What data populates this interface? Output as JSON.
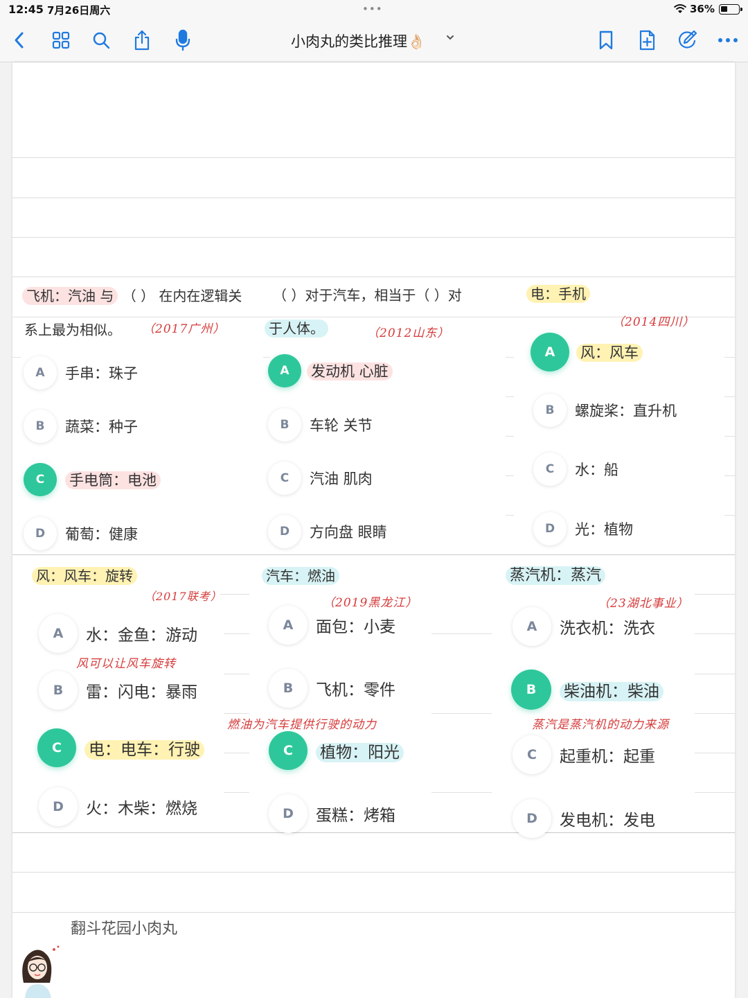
{
  "status_bar": {
    "time": "12:45",
    "date": "7月26日周六",
    "dots": "•••",
    "battery": "36%"
  },
  "toolbar": {
    "title": "小肉丸的类比推理👌🏻",
    "icons": [
      "back-icon",
      "grid-icon",
      "search-icon",
      "share-icon",
      "microphone-icon",
      "bookmark-icon",
      "add-page-icon",
      "markup-icon",
      "more-icon"
    ]
  },
  "q1": {
    "stem_hl": "飞机：汽油 与",
    "stem_rest": "（ ） 在内在逻辑关",
    "stem_line2": "系上最为相似。",
    "source": "（2017广州）",
    "options": [
      {
        "letter": "A",
        "text": "手串：珠子"
      },
      {
        "letter": "B",
        "text": "蔬菜：种子"
      },
      {
        "letter": "C",
        "text": "手电筒：电池"
      },
      {
        "letter": "D",
        "text": "葡萄：健康"
      }
    ]
  },
  "q2": {
    "stem_line1": "（    ）对于汽车，相当于（    ）对",
    "stem_line2": "于人体。",
    "source": "（2012山东）",
    "options": [
      {
        "letter": "A",
        "text": "发动机 心脏"
      },
      {
        "letter": "B",
        "text": "车轮 关节"
      },
      {
        "letter": "C",
        "text": "汽油 肌肉"
      },
      {
        "letter": "D",
        "text": "方向盘 眼睛"
      }
    ]
  },
  "q3": {
    "stem": "电：手机",
    "source": "（2014四川）",
    "options": [
      {
        "letter": "A",
        "text": "风：风车"
      },
      {
        "letter": "B",
        "text": "螺旋桨：直升机"
      },
      {
        "letter": "C",
        "text": "水：船"
      },
      {
        "letter": "D",
        "text": "光：植物"
      }
    ]
  },
  "q4": {
    "stem": "风：风车：旋转",
    "source": "（2017联考）",
    "note": "风可以让风车旋转",
    "options": [
      {
        "letter": "A",
        "text": "水：金鱼：游动"
      },
      {
        "letter": "B",
        "text": "雷：闪电：暴雨"
      },
      {
        "letter": "C",
        "text": "电：电车：行驶"
      },
      {
        "letter": "D",
        "text": "火：木柴：燃烧"
      }
    ]
  },
  "q5": {
    "stem": "汽车：燃油",
    "source": "（2019黑龙江）",
    "note": "燃油为汽车提供行驶的动力",
    "options": [
      {
        "letter": "A",
        "text": "面包：小麦"
      },
      {
        "letter": "B",
        "text": "飞机：零件"
      },
      {
        "letter": "C",
        "text": "植物：阳光"
      },
      {
        "letter": "D",
        "text": "蛋糕：烤箱"
      }
    ]
  },
  "q6": {
    "stem": "蒸汽机：蒸汽",
    "source": "（23湖北事业）",
    "note": "蒸汽是蒸汽机的动力来源",
    "options": [
      {
        "letter": "A",
        "text": "洗衣机：洗衣"
      },
      {
        "letter": "B",
        "text": "柴油机：柴油"
      },
      {
        "letter": "C",
        "text": "起重机：起重"
      },
      {
        "letter": "D",
        "text": "发电机：发电"
      }
    ]
  },
  "footer": {
    "author": "翻斗花园小肉丸"
  },
  "colors": {
    "accent": "#2ec79b",
    "note_red": "#d63b3b",
    "icon_blue": "#1f7ae0"
  }
}
